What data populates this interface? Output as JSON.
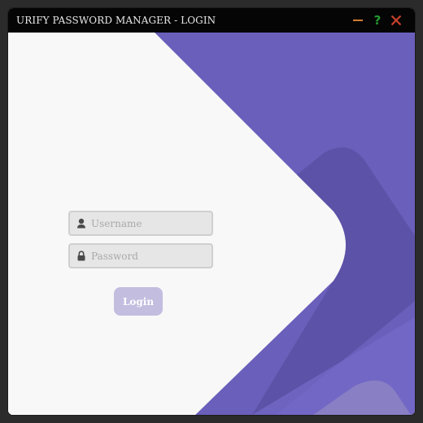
{
  "window": {
    "title": "URIFY PASSWORD MANAGER - LOGIN",
    "controls": {
      "minimize_icon": "minimize-icon",
      "help_label": "?",
      "close_icon": "close-icon"
    }
  },
  "login_form": {
    "username": {
      "value": "",
      "placeholder": "Username",
      "icon": "user-icon"
    },
    "password": {
      "value": "",
      "placeholder": "Password",
      "icon": "lock-icon"
    },
    "login_label": "Login"
  },
  "colors": {
    "titlebar": "#050505",
    "panel": "#f8f8f8",
    "accent_purple": "#6a5fba",
    "login_button": "#c3bde0",
    "minimize": "#d27d2d",
    "help": "#239b32",
    "close": "#c8412d"
  }
}
